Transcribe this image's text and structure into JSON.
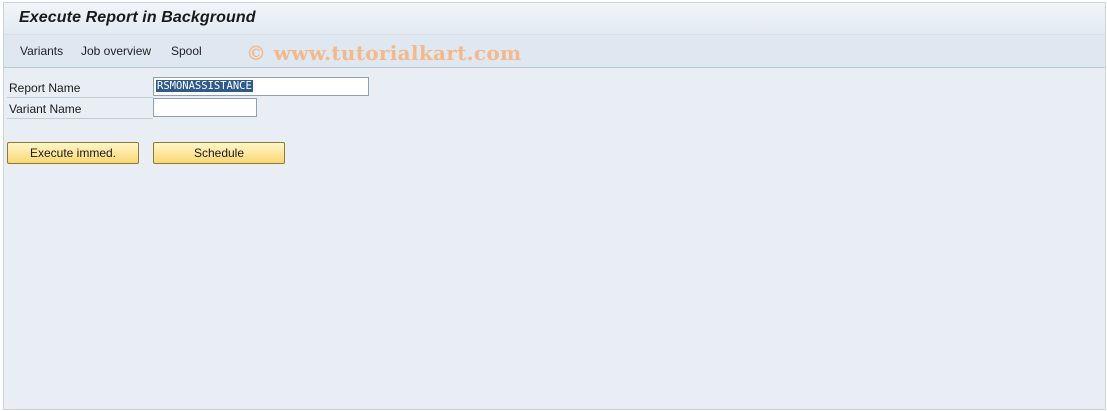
{
  "window": {
    "title": "Execute Report in Background"
  },
  "menu": {
    "items": [
      "Variants",
      "Job overview",
      "Spool"
    ]
  },
  "watermark": "© www.tutorialkart.com",
  "form": {
    "report_name": {
      "label": "Report Name",
      "value": "RSMONASSISTANCE"
    },
    "variant_name": {
      "label": "Variant Name",
      "value": ""
    }
  },
  "buttons": {
    "execute_immed": "Execute immed.",
    "schedule": "Schedule"
  },
  "colors": {
    "background": "#e8eef4",
    "button": "#f9d874",
    "selection": "#2f5b8c",
    "watermark": "#f3b98c"
  }
}
